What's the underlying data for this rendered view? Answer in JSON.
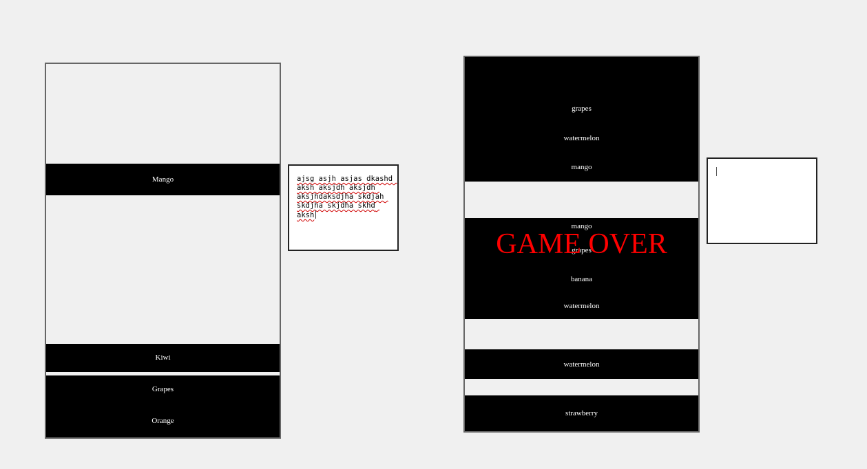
{
  "left_board": {
    "blocks": [
      {
        "label": "Mango"
      },
      {
        "label": "Kiwi"
      },
      {
        "label": "Grapes"
      },
      {
        "label": "Orange"
      }
    ]
  },
  "left_textbox": {
    "value": "ajsg asjh asjas dkashd aksh aksjdh aksjdh aksjhdaksdjha skdjah skdjha skjdha skhd aksh"
  },
  "right_board": {
    "labels": [
      "grapes",
      "watermelon",
      "mango",
      "mango",
      "grapes",
      "banana",
      "watermelon",
      "watermelon",
      "strawberry"
    ],
    "game_over_text": "GAME OVER",
    "game_over_color": "#ff0000"
  },
  "right_textbox": {
    "value": ""
  },
  "colors": {
    "background": "#f0f0f0",
    "block": "#000000",
    "block_text": "#ffffff"
  }
}
